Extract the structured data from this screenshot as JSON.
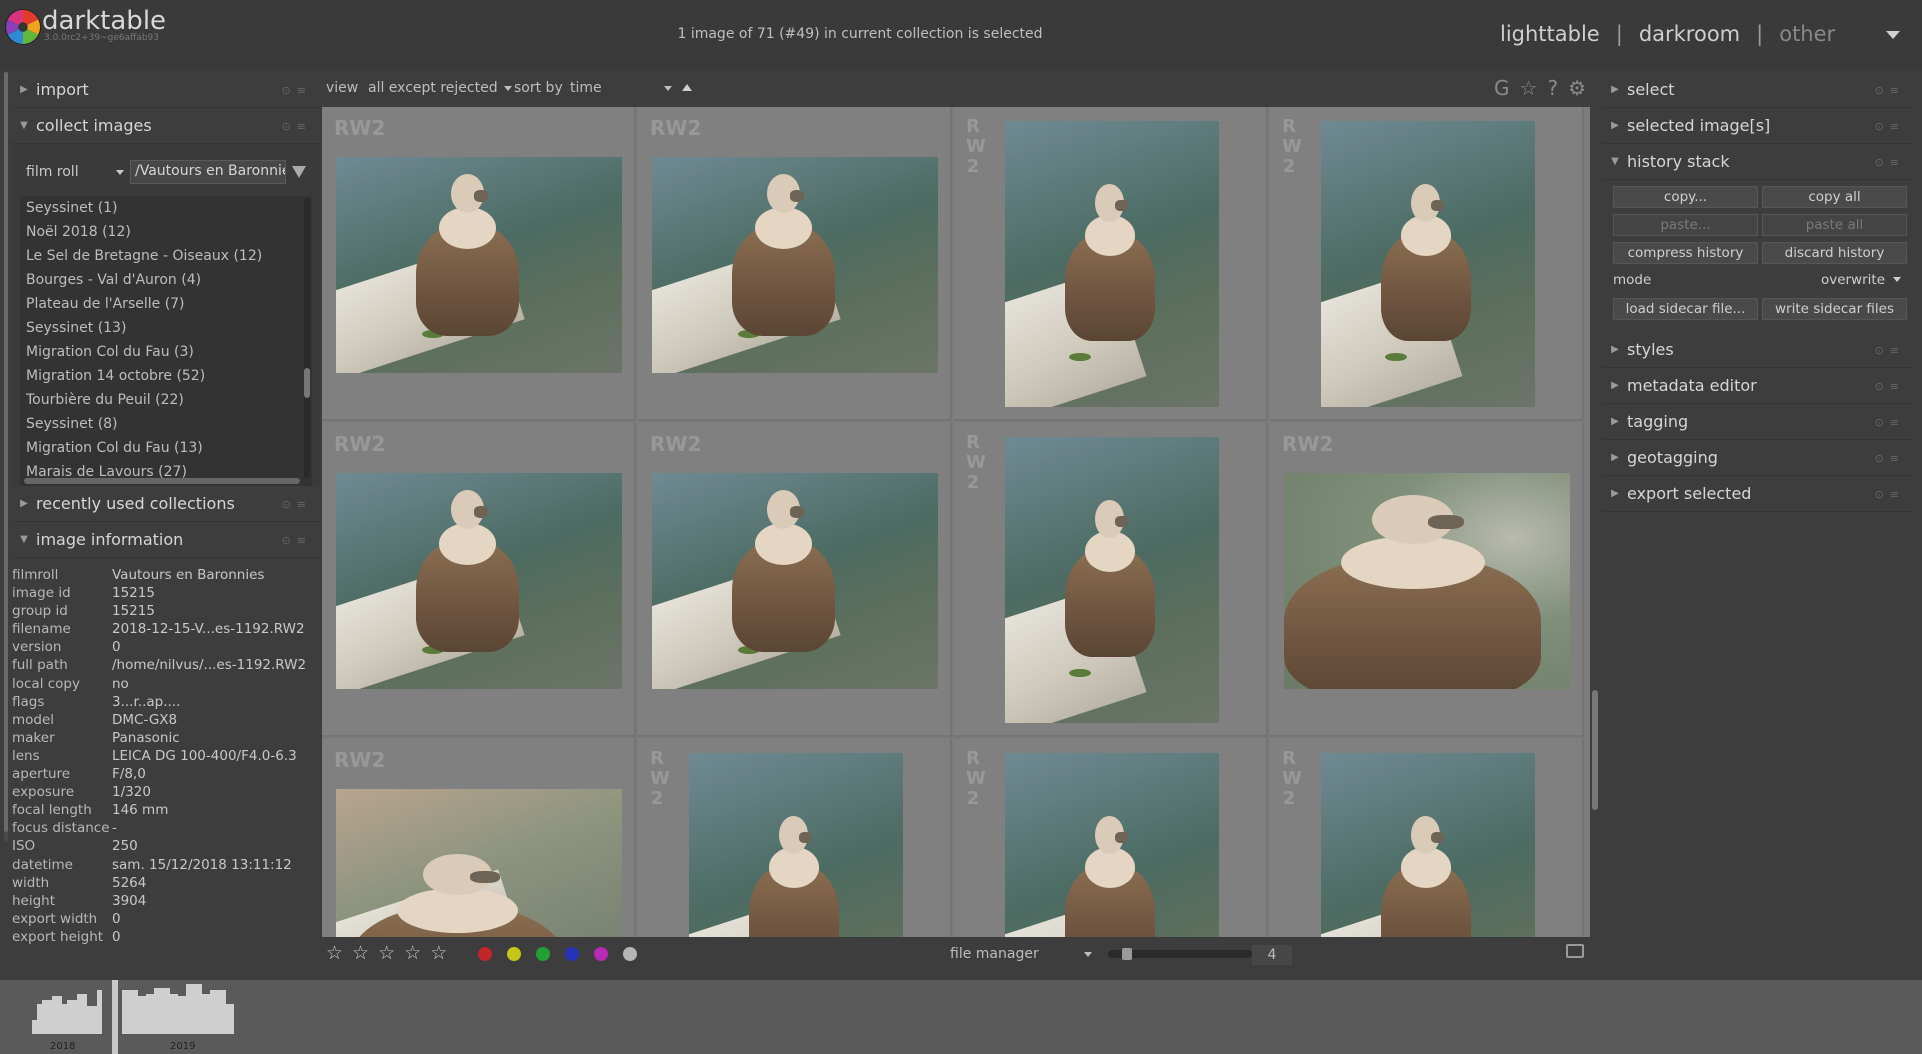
{
  "header": {
    "app_name": "darktable",
    "version": "3.0.0rc2+39~ge6affab93",
    "collection_status": "1 image of 71 (#49) in current collection is selected",
    "views": [
      "lighttable",
      "darkroom",
      "other"
    ]
  },
  "left_panel": {
    "import_label": "import",
    "collect_label": "collect images",
    "collect_property": "film roll",
    "collect_value": "/Vautours en Baronnies",
    "film_rolls": [
      "Seyssinet (1)",
      "Noël 2018 (12)",
      "Le Sel de Bretagne - Oiseaux (12)",
      "Bourges - Val d'Auron (4)",
      "Plateau de l'Arselle (7)",
      "Seyssinet (13)",
      "Migration Col du Fau (3)",
      "Migration 14 octobre (52)",
      "Tourbière du Peuil (22)",
      "Seyssinet (8)",
      "Migration Col du Fau (13)",
      "Marais de Lavours (27)"
    ],
    "recent_label": "recently used collections",
    "info_label": "image information",
    "image_info": [
      {
        "key": "filmroll",
        "value": "Vautours en Baronnies"
      },
      {
        "key": "image id",
        "value": "15215"
      },
      {
        "key": "group id",
        "value": "15215"
      },
      {
        "key": "filename",
        "value": "2018-12-15-V...es-1192.RW2"
      },
      {
        "key": "version",
        "value": "0"
      },
      {
        "key": "full path",
        "value": "/home/nilvus/...es-1192.RW2"
      },
      {
        "key": "local copy",
        "value": "no"
      },
      {
        "key": "flags",
        "value": "3...r..ap...."
      },
      {
        "key": "model",
        "value": "DMC-GX8"
      },
      {
        "key": "maker",
        "value": "Panasonic"
      },
      {
        "key": "lens",
        "value": "LEICA DG 100-400/F4.0-6.3"
      },
      {
        "key": "aperture",
        "value": "F/8,0"
      },
      {
        "key": "exposure",
        "value": "1/320"
      },
      {
        "key": "focal length",
        "value": "146 mm"
      },
      {
        "key": "focus distance",
        "value": "-"
      },
      {
        "key": "ISO",
        "value": "250"
      },
      {
        "key": "datetime",
        "value": "sam. 15/12/2018 13:11:12"
      },
      {
        "key": "width",
        "value": "5264"
      },
      {
        "key": "height",
        "value": "3904"
      },
      {
        "key": "export width",
        "value": "0"
      },
      {
        "key": "export height",
        "value": "0"
      }
    ]
  },
  "center": {
    "view_label": "view",
    "view_filter": "all except rejected",
    "sort_label": "sort by",
    "sort_value": "time",
    "toolbar_icons": [
      "G",
      "☆",
      "?",
      "⚙"
    ],
    "thumbnails": [
      {
        "label": "RW2",
        "orientation": "landscape"
      },
      {
        "label": "RW2",
        "orientation": "landscape"
      },
      {
        "label": "RW2",
        "orientation": "portrait"
      },
      {
        "label": "RW2",
        "orientation": "portrait"
      },
      {
        "label": "RW2",
        "orientation": "landscape"
      },
      {
        "label": "RW2",
        "orientation": "landscape"
      },
      {
        "label": "RW2",
        "orientation": "portrait"
      },
      {
        "label": "RW2",
        "orientation": "landscape"
      },
      {
        "label": "RW2",
        "orientation": "landscape"
      },
      {
        "label": "RW2",
        "orientation": "portrait"
      },
      {
        "label": "RW2",
        "orientation": "portrait"
      },
      {
        "label": "RW2",
        "orientation": "portrait"
      }
    ],
    "star_glyph": "☆",
    "color_labels": [
      "#c0262a",
      "#c6c617",
      "#23a032",
      "#2233b8",
      "#b62ab6",
      "#b5b5b5"
    ],
    "layout_mode": "file manager",
    "zoom_value": "4"
  },
  "right_panel": {
    "select_label": "select",
    "selected_images_label": "selected image[s]",
    "history_label": "history stack",
    "btn_copy": "copy...",
    "btn_copy_all": "copy all",
    "btn_paste": "paste...",
    "btn_paste_all": "paste all",
    "btn_compress": "compress history",
    "btn_discard": "discard history",
    "mode_label": "mode",
    "mode_value": "overwrite",
    "btn_load_sidecar": "load sidecar file...",
    "btn_write_sidecar": "write sidecar files",
    "styles_label": "styles",
    "metadata_label": "metadata editor",
    "tagging_label": "tagging",
    "geotagging_label": "geotagging",
    "export_label": "export selected"
  },
  "timeline": {
    "years": [
      "2018",
      "2019"
    ]
  }
}
